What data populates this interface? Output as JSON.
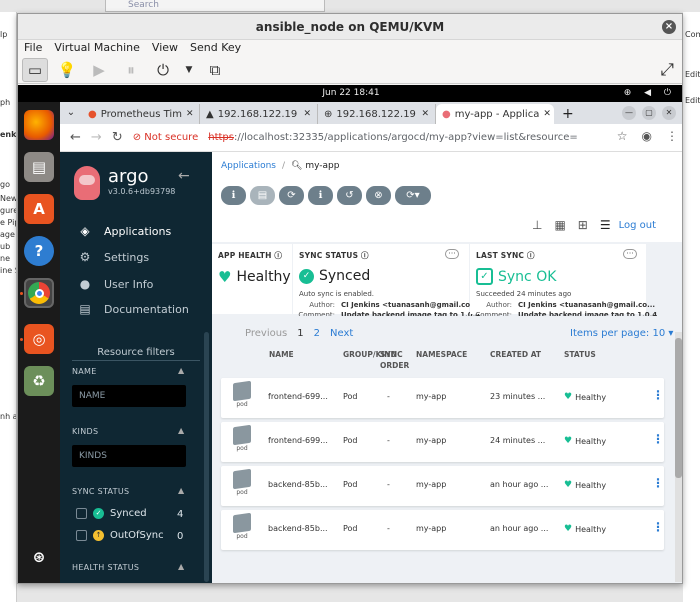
{
  "background": {
    "search_placeholder": "Search",
    "left_fragments": [
      "lp",
      "ph",
      "enki",
      "go",
      "New",
      "gure",
      "e Pipeli",
      "age Ver",
      "ub",
      "ne",
      "ine Sync",
      "nh at"
    ],
    "right_fragments": [
      "Comm",
      "Edit",
      "Edit"
    ]
  },
  "qemu": {
    "title": "ansible_node on QEMU/KVM",
    "menu": [
      "File",
      "Virtual Machine",
      "View",
      "Send Key"
    ],
    "close": "×"
  },
  "guest": {
    "clock": "Jun 22  18:41",
    "tray": "⊕ ◀ ⏻"
  },
  "dock": {
    "icons": [
      "firefox-icon",
      "files-icon",
      "app-center-icon",
      "help-icon",
      "chrome-icon",
      "ubuntu-icon",
      "trash-icon",
      "apps-grid-icon"
    ]
  },
  "browser": {
    "tabs": [
      {
        "label": "Prometheus Tim",
        "icon": "prometheus-icon"
      },
      {
        "label": "192.168.122.19",
        "icon": "triangle-icon"
      },
      {
        "label": "192.168.122.19",
        "icon": "globe-icon"
      },
      {
        "label": "my-app - Applica",
        "icon": "argo-icon"
      }
    ],
    "not_secure": "Not secure",
    "url_scheme": "https",
    "url_rest": "://localhost:32335/applications/argocd/my-app?view=list&resource="
  },
  "sidebar": {
    "brand": "argo",
    "version": "v3.0.6+db93798",
    "nav": [
      "Applications",
      "Settings",
      "User Info",
      "Documentation"
    ],
    "resource_filters": "Resource filters",
    "name_label": "NAME",
    "name_placeholder": "NAME",
    "kinds_label": "KINDS",
    "kinds_placeholder": "KINDS",
    "sync_status_label": "SYNC STATUS",
    "synced": "Synced",
    "synced_count": "4",
    "outofsync": "OutOfSync",
    "outofsync_count": "0",
    "health_status_label": "HEALTH STATUS"
  },
  "header": {
    "breadcrumb_root": "Applications",
    "breadcrumb_app": "my-app",
    "logout": "Log out"
  },
  "status": {
    "app_health_label": "APP HEALTH",
    "app_health": "Healthy",
    "sync_status_label": "SYNC STATUS",
    "sync_status": "Synced",
    "auto_sync": "Auto sync is enabled.",
    "author_label": "Author:",
    "author": "CI Jenkins <tuanasanh@gmail.co...",
    "comment_label": "Comment:",
    "comment": "Update backend image tag to 1.0.4",
    "last_sync_label": "LAST SYNC",
    "last_sync": "Sync OK",
    "succeeded": "Succeeded 24 minutes ago",
    "last_author": "CI Jenkins <tuanasanh@gmail.co...",
    "last_comment": "Update backend image tag to 1.0.4"
  },
  "list": {
    "previous": "Previous",
    "page1": "1",
    "page2": "2",
    "next": "Next",
    "items_per_page": "Items per page: 10 ▾",
    "columns": [
      "NAME",
      "GROUP/KIND",
      "SYNC ORDER",
      "NAMESPACE",
      "CREATED AT",
      "STATUS"
    ],
    "pod_label": "pod",
    "rows": [
      {
        "name": "frontend-699...",
        "kind": "Pod",
        "order": "-",
        "namespace": "my-app",
        "created": "23 minutes ...",
        "status": "Healthy"
      },
      {
        "name": "frontend-699...",
        "kind": "Pod",
        "order": "-",
        "namespace": "my-app",
        "created": "24 minutes ...",
        "status": "Healthy"
      },
      {
        "name": "backend-85b...",
        "kind": "Pod",
        "order": "-",
        "namespace": "my-app",
        "created": "an hour ago ...",
        "status": "Healthy"
      },
      {
        "name": "backend-85b...",
        "kind": "Pod",
        "order": "-",
        "namespace": "my-app",
        "created": "an hour ago ...",
        "status": "Healthy"
      }
    ]
  },
  "colors": {
    "accent": "#2b7cd3",
    "healthy": "#18be94",
    "sidebar": "#0f2733"
  }
}
